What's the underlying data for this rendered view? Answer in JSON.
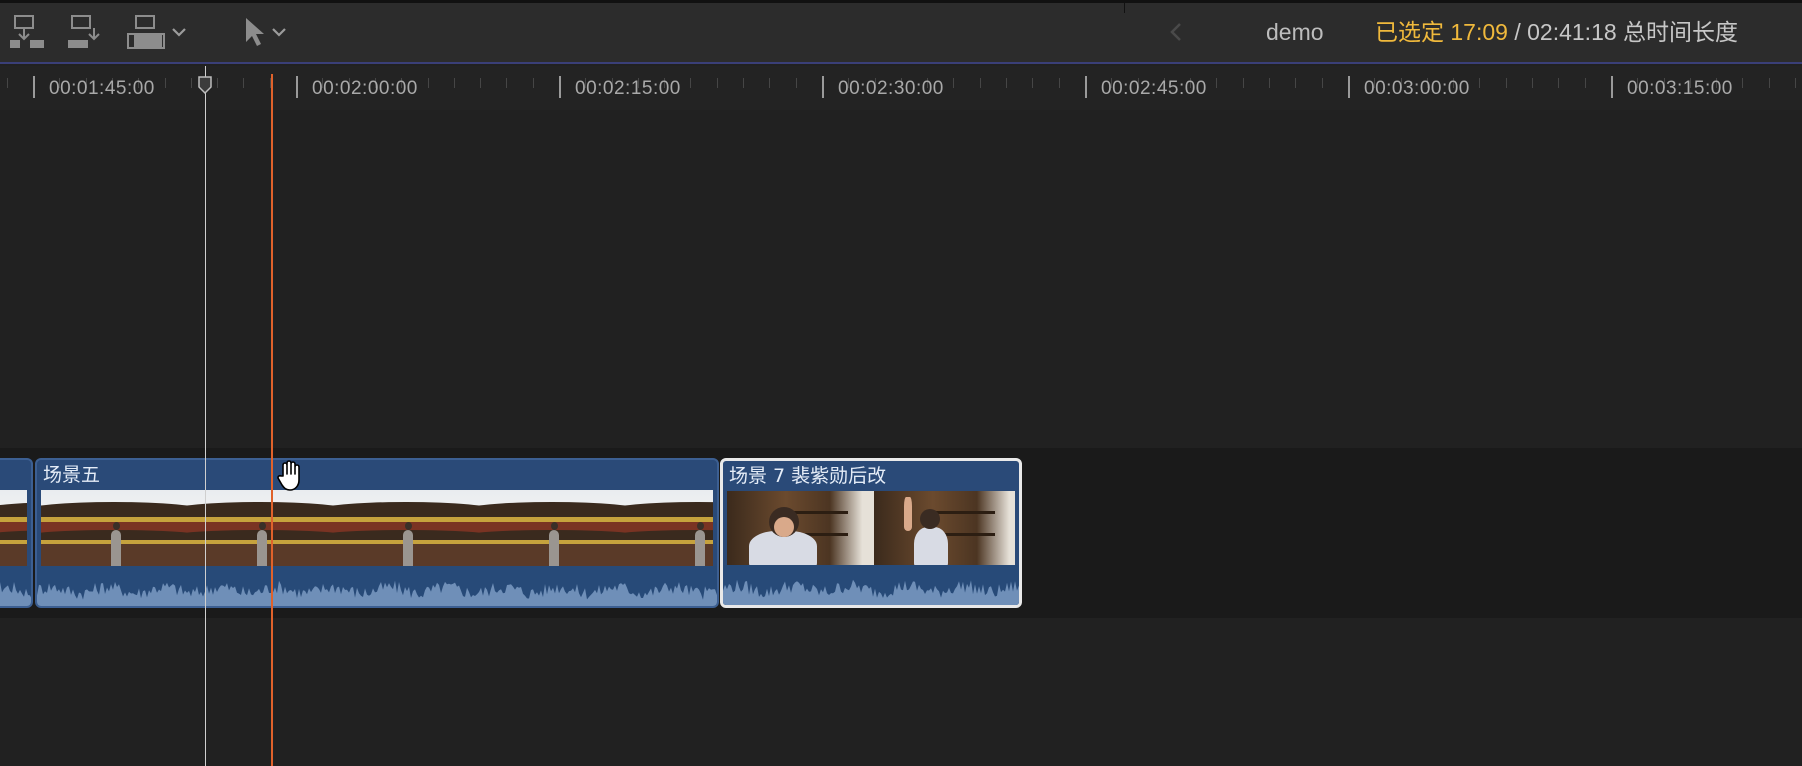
{
  "toolbar": {
    "buttons": [
      {
        "name": "connect-clip-icon"
      },
      {
        "name": "insert-clip-icon"
      },
      {
        "name": "append-clip-icon"
      },
      {
        "name": "select-tool-icon"
      }
    ],
    "project_name": "demo",
    "selected_label": "已选定 17:09",
    "total_label": " / 02:41:18 总时间长度"
  },
  "ruler": {
    "timecodes": [
      "00:01:45:00",
      "00:02:00:00",
      "00:02:15:00",
      "00:02:30:00",
      "00:02:45:00",
      "00:03:00:00",
      "00:03:15:00"
    ]
  },
  "timeline": {
    "clips": [
      {
        "title": "",
        "kind": "temple",
        "selected": false
      },
      {
        "title": "场景五",
        "kind": "temple",
        "selected": false
      },
      {
        "title": "场景 7 裴紫勋后改",
        "kind": "room",
        "selected": true
      }
    ]
  },
  "colors": {
    "accent_selected": "#f0b93c",
    "clip_blue": "#2a4a78",
    "playhead": "#e0622b",
    "toolbar_border": "#3a3f78"
  }
}
